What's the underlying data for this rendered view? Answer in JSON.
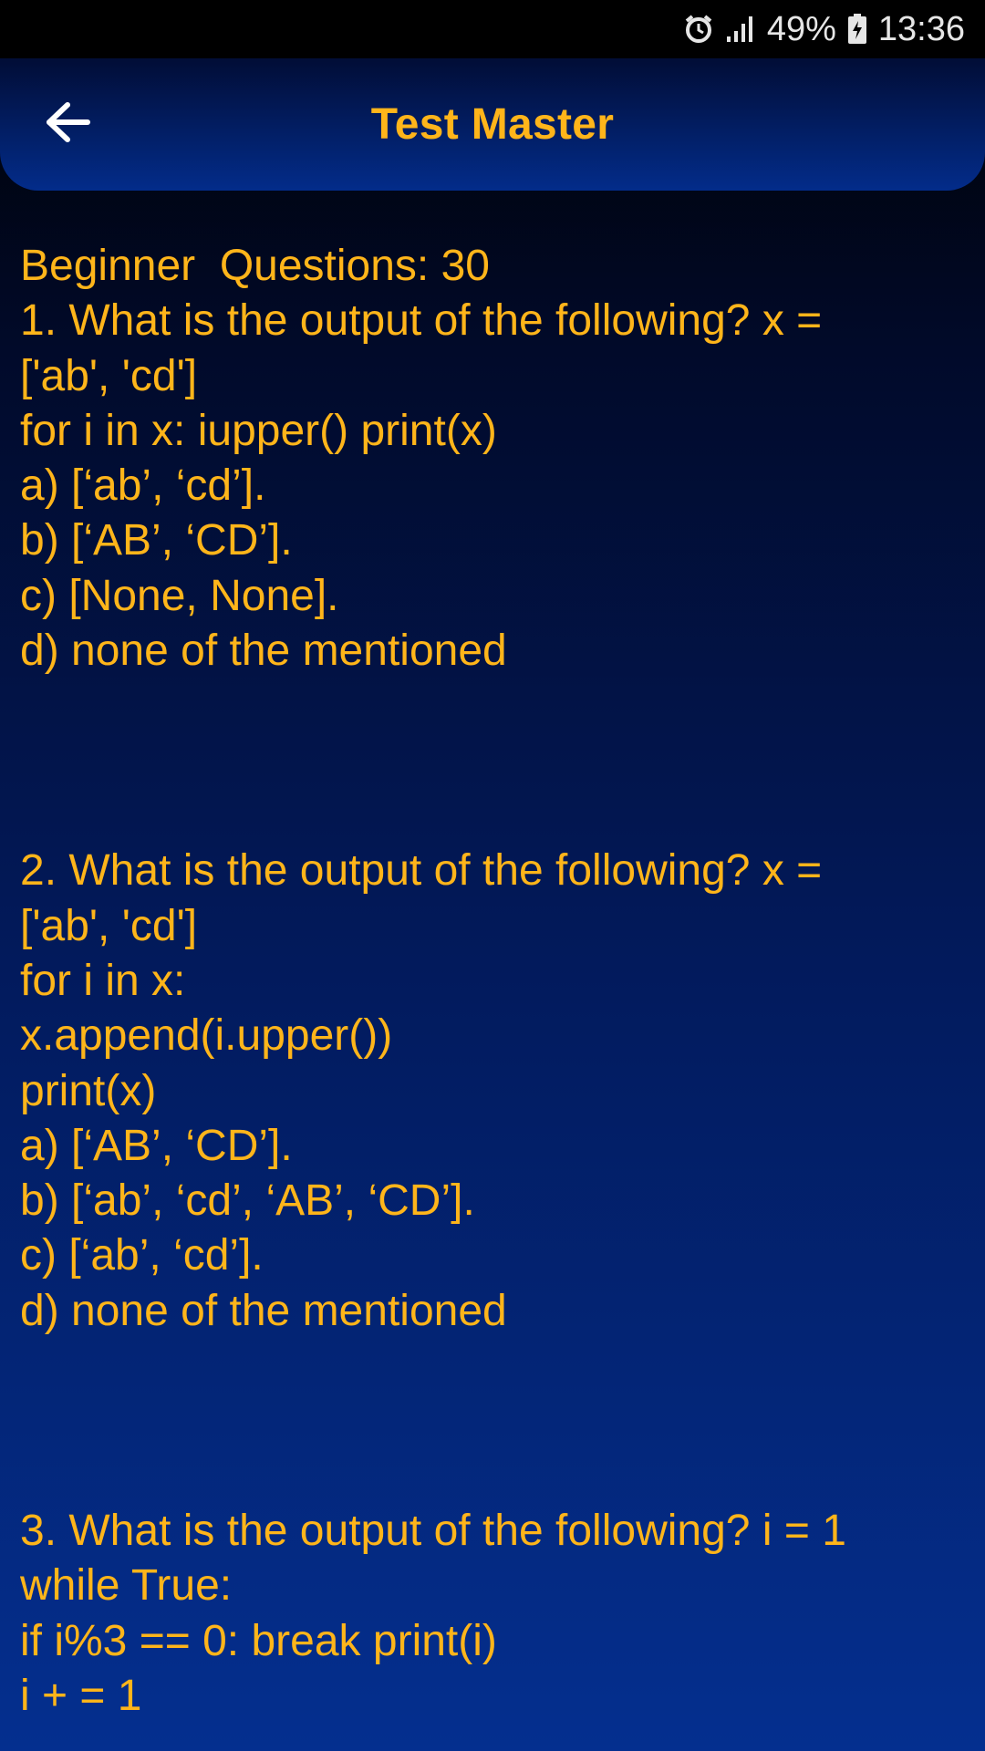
{
  "status_bar": {
    "battery": "49%",
    "time": "13:36",
    "icons": [
      "alarm-icon",
      "signal-icon",
      "battery-charging-icon"
    ]
  },
  "header": {
    "title": "Test Master",
    "back_icon": "arrow-left-icon"
  },
  "content": {
    "heading": "Beginner  Questions: 30",
    "questions": [
      {
        "lines": [
          "1. What is the output of the following? x =",
          "['ab', 'cd']",
          "for i in x: iupper() print(x)"
        ],
        "options": [
          "a) [‘ab’, ‘cd’].",
          "b) [‘AB’, ‘CD’].",
          "c) [None, None].",
          "d) none of the mentioned"
        ]
      },
      {
        "lines": [
          "2. What is the output of the following? x =",
          "['ab', 'cd']",
          "for i in x:",
          "x.append(i.upper())",
          "print(x)"
        ],
        "options": [
          "a) [‘AB’, ‘CD’].",
          "b) [‘ab’, ‘cd’, ‘AB’, ‘CD’].",
          "c) [‘ab’, ‘cd’].",
          "d) none of the mentioned"
        ]
      },
      {
        "lines": [
          "3. What is the output of the following? i = 1",
          "while True:",
          "if i%3 == 0: break print(i)",
          "i + = 1"
        ],
        "options": []
      }
    ]
  },
  "colors": {
    "accent": "#ffb51a",
    "background_top": "#000000",
    "background_bottom": "#042f8f"
  }
}
